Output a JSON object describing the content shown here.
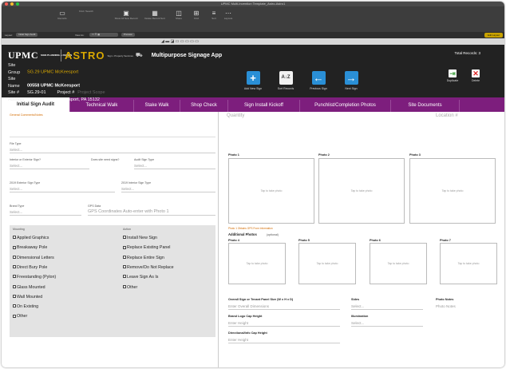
{
  "window": {
    "title": "UPMC Multi-Invention Template_Astro-Astro1"
  },
  "toolbar": [
    {
      "glyph": "▭",
      "label": "Records"
    },
    {
      "glyph": "",
      "label": "Find / Search"
    },
    {
      "glyph": "▣",
      "label": "Show All New Record"
    },
    {
      "glyph": "▦",
      "label": "Delete Record Sort"
    },
    {
      "glyph": "◫",
      "label": "Share"
    },
    {
      "glyph": "⊞",
      "label": "Find"
    },
    {
      "glyph": "≡",
      "label": "Sort"
    },
    {
      "glyph": "⋯",
      "label": "Layouts"
    }
  ],
  "layoutbar": {
    "layout_label": "Layout:",
    "layout_value": "Initial Sign Audit",
    "view_label": "View As:",
    "preview": "Preview",
    "edit": "Edit Layout"
  },
  "header": {
    "brand": "UPMC",
    "subbrand": "SIGN PLANNING & DESIGN",
    "astro": "ASTRO",
    "astro_sub": "Sign • Property Services",
    "app_title": "Multipurpose Signage App",
    "total_records": "Total Records: 3",
    "info": [
      {
        "key": "Site Group",
        "value": "SG.29 UPMC McKeesport",
        "style": "gold"
      },
      {
        "key": "Site Name",
        "value": "00558 UPMC McKeesport",
        "style": "bold"
      },
      {
        "key": "Site #",
        "value": "SG.29-01",
        "extra_key": "Project #",
        "extra_value": "Project Scope"
      },
      {
        "key": "Address",
        "value": "1500 5th Ave, McKeesport, PA 15132"
      }
    ],
    "buttons": [
      {
        "glyph": "+",
        "label": "Add New Sign",
        "color": "#2a8fd6"
      },
      {
        "glyph": "A↓Z",
        "label": "Sort Records",
        "color": "#f2f2f2"
      },
      {
        "glyph": "←",
        "label": "Previous Sign",
        "color": "#2a8fd6"
      },
      {
        "glyph": "→",
        "label": "Next Sign",
        "color": "#2a8fd6"
      }
    ],
    "small_buttons": [
      {
        "glyph": "⇥",
        "label": "Duplicate",
        "color": "#4ea84e"
      },
      {
        "glyph": "✕",
        "label": "Delete",
        "color": "#d22"
      }
    ]
  },
  "tabs": [
    "Initial Sign Audit",
    "Technical Walk",
    "Stake Walk",
    "Shop Check",
    "Sign Install Kickoff",
    "Punchlist/Completion Photos",
    "Site Documents"
  ],
  "left": {
    "general_comments_label": "General Comments/Notes",
    "file_type_label": "File Type",
    "file_type_value": "Select...",
    "interior_label": "Interior or Exterior Sign?",
    "interior_value": "Select...",
    "new_sign_label": "Does site need signs?",
    "audit_type_label": "Audit Sign Type",
    "audit_type_value": "Select...",
    "ext_type_label": "2019 Exterior Sign Type",
    "ext_type_value": "Select...",
    "int_type_label": "2019 Interior Sign Type",
    "int_type_value": "Select...",
    "brand_label": "Brand Type",
    "brand_value": "Select...",
    "gps_label": "GPS Data",
    "gps_value": "GPS Coordinates Auto-enter with Photo 1",
    "mounting_label": "Mounting",
    "mounting": [
      "Applied Graphics",
      "Breakaway Pole",
      "Dimensional Letters",
      "Direct Bury Pole",
      "Freestanding (Pylon)",
      "Glass Mounted",
      "Wall Mounted",
      "On Existing",
      "Other"
    ],
    "action_label": "Action",
    "actions": [
      "Install New Sign",
      "Replace Existing Panel",
      "Replace Entire Sign",
      "Remove/Do Not Replace",
      "Leave Sign As Is",
      "Other"
    ]
  },
  "right": {
    "quantity": "Quantity",
    "location": "Location #",
    "photos_top": [
      "Photo 1",
      "Photo 2",
      "Photo 3"
    ],
    "photo_placeholder": "Tap to take photo",
    "photo_warning": "Photo 1 Obtains GPS From Information",
    "additional_label": "Additional Photos",
    "additional_note": "(optional)",
    "photos_bottom": [
      "Photo 4",
      "Photo 5",
      "Photo 6",
      "Photo 7"
    ],
    "size_label": "Overall Sign or Tenant Panel Size (W x H x D)",
    "size_value": "Enter Overall Dimensions",
    "sides_label": "Sides",
    "sides_value": "Select...",
    "notes_label": "Photo Notes",
    "notes_value": "Photo Notes",
    "logo_label": "Brand Logo Cap Height",
    "logo_value": "Enter Height",
    "illum_label": "Illumination",
    "illum_value": "Select...",
    "dir_label": "Directional/Info Cap Height",
    "dir_value": "Enter Height"
  }
}
